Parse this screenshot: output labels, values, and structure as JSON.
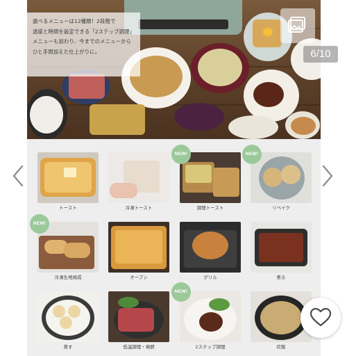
{
  "hero": {
    "caption_lines": [
      "選べるメニューは12種類！2段階で",
      "温度と時間を設定できる「2ステップ調理」",
      "メニューも加わり、今までのメニューから",
      "ひと手間加えた仕上がりに。"
    ]
  },
  "viewer": {
    "page_counter": "6/10",
    "gallery_icon": "gallery-icon",
    "prev_icon": "chevron-left-icon",
    "next_icon": "chevron-right-icon",
    "favorite_icon": "heart-icon"
  },
  "menu": {
    "badge_text": "NEW!",
    "items": [
      {
        "label": "トースト",
        "new": false
      },
      {
        "label": "冷凍トースト",
        "new": false
      },
      {
        "label": "調理トースト",
        "new": true
      },
      {
        "label": "リベイク",
        "new": true
      },
      {
        "label": "冷凍生地焼成",
        "new": true
      },
      {
        "label": "オーブン",
        "new": false
      },
      {
        "label": "グリル",
        "new": false
      },
      {
        "label": "煮る",
        "new": false
      },
      {
        "label": "蒸す",
        "new": false
      },
      {
        "label": "低温調理・発酵",
        "new": false
      },
      {
        "label": "2ステップ調理",
        "new": true
      },
      {
        "label": "炊飯",
        "new": false
      }
    ]
  },
  "colors": {
    "badge": "#9cc99a",
    "panel": "#eeeeef",
    "arrow": "#8a8a8a"
  }
}
